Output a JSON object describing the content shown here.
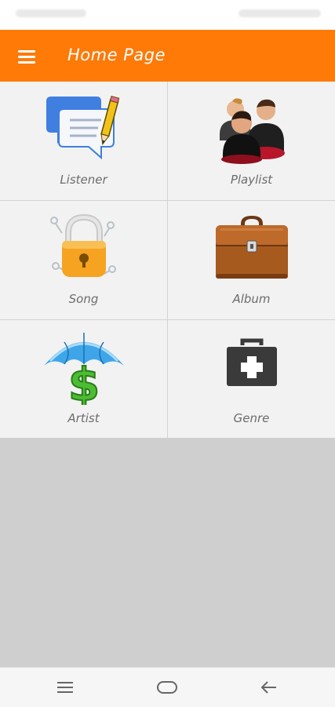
{
  "app_bar": {
    "title": "Home Page",
    "background_color": "#ff7a07",
    "menu_icon": "hamburger-menu-icon"
  },
  "tiles": [
    {
      "label": "Listener",
      "icon": "chat-edit-icon"
    },
    {
      "label": "Playlist",
      "icon": "people-icon"
    },
    {
      "label": "Song",
      "icon": "padlock-icon"
    },
    {
      "label": "Album",
      "icon": "briefcase-icon"
    },
    {
      "label": "Artist",
      "icon": "umbrella-dollar-icon"
    },
    {
      "label": "Genre",
      "icon": "first-aid-kit-icon"
    }
  ],
  "system_nav": {
    "icons": [
      "recent-apps-icon",
      "home-icon",
      "back-icon"
    ]
  }
}
